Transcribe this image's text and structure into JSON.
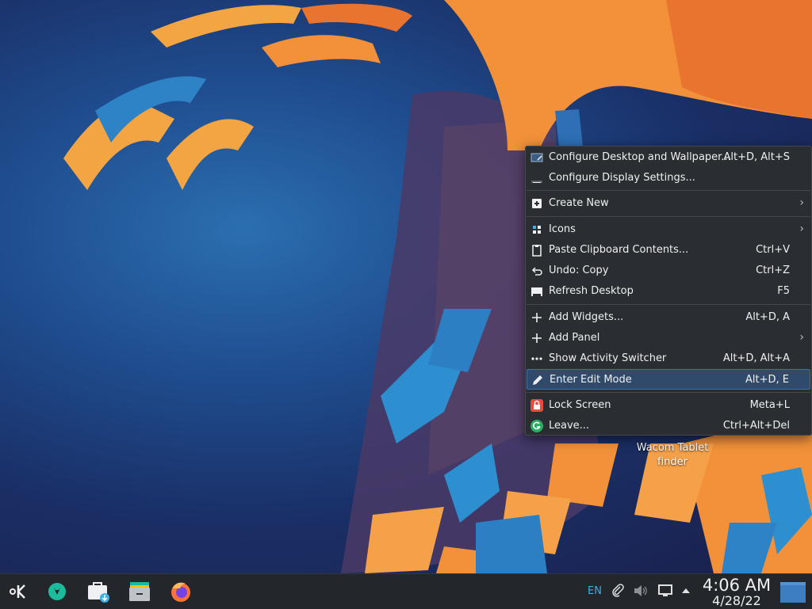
{
  "desktop": {
    "icon_label_line1": "Wacom Tablet",
    "icon_label_line2": "finder"
  },
  "context_menu": {
    "items": [
      {
        "label": "Configure Desktop and Wallpaper...",
        "shortcut": "Alt+D, Alt+S",
        "icon": "configure-desktop-icon"
      },
      {
        "label": "Configure Display Settings...",
        "shortcut": "",
        "icon": "display-settings-icon"
      },
      {
        "label": "Create New",
        "shortcut": "",
        "icon": "create-new-icon",
        "submenu": true
      },
      {
        "label": "Icons",
        "shortcut": "",
        "icon": "icons-grid-icon",
        "submenu": true
      },
      {
        "label": "Paste Clipboard Contents...",
        "shortcut": "Ctrl+V",
        "icon": "clipboard-icon"
      },
      {
        "label": "Undo: Copy",
        "shortcut": "Ctrl+Z",
        "icon": "undo-icon"
      },
      {
        "label": "Refresh Desktop",
        "shortcut": "F5",
        "icon": "refresh-desktop-icon"
      },
      {
        "label": "Add Widgets...",
        "shortcut": "Alt+D, A",
        "icon": "plus-icon"
      },
      {
        "label": "Add Panel",
        "shortcut": "",
        "icon": "plus-icon",
        "submenu": true
      },
      {
        "label": "Show Activity Switcher",
        "shortcut": "Alt+D, Alt+A",
        "icon": "activities-icon"
      },
      {
        "label": "Enter Edit Mode",
        "shortcut": "Alt+D, E",
        "icon": "edit-pencil-icon",
        "highlighted": true
      },
      {
        "label": "Lock Screen",
        "shortcut": "Meta+L",
        "icon": "lock-icon"
      },
      {
        "label": "Leave...",
        "shortcut": "Ctrl+Alt+Del",
        "icon": "leave-icon"
      }
    ],
    "submenu_arrow": "›"
  },
  "taskbar": {
    "apps": [
      "kde-launcher-icon",
      "discover-icon",
      "software-center-icon",
      "file-manager-icon",
      "firefox-icon"
    ],
    "lang": "EN",
    "clock_time": "4:06 AM",
    "clock_date": "4/28/22"
  },
  "colors": {
    "accent": "#3daee9",
    "menu_bg": "#2a2e32",
    "highlight_bg": "#2f4a6b",
    "lock_red": "#da4453",
    "leave_green": "#27ae60",
    "wallpaper_orange": "#f2913a"
  }
}
